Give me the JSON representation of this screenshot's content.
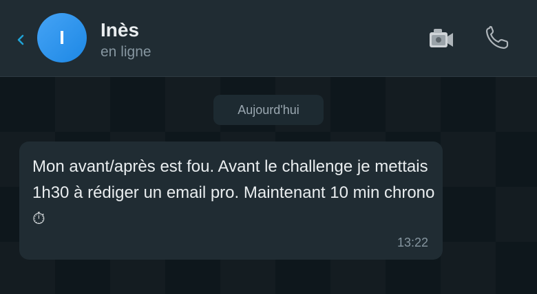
{
  "header": {
    "back_icon": "chevron-left-icon",
    "avatar_initial": "I",
    "contact_name": "Inès",
    "contact_status": "en ligne",
    "video_icon": "video-camera-icon",
    "call_icon": "phone-icon"
  },
  "chat": {
    "date_separator": "Aujourd'hui",
    "messages": [
      {
        "text": "Mon avant/après est fou. Avant le challenge je mettais 1h30 à rédiger un email pro. Maintenant 10 min chrono ⏱",
        "time": "13:22"
      }
    ]
  },
  "colors": {
    "header_bg": "#202c33",
    "chat_bg": "#0b141a",
    "bubble_bg": "#202c33",
    "accent": "#1fa3d6",
    "avatar": "#2a8ee6"
  }
}
